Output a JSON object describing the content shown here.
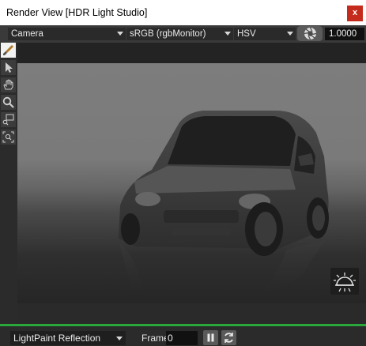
{
  "window": {
    "title": "Render View [HDR Light Studio]",
    "close_label": "x"
  },
  "toolbar": {
    "view_mode": "Camera",
    "color_space": "sRGB (rgbMonitor)",
    "color_model": "HSV",
    "exposure_value": "1.0000"
  },
  "tools": [
    {
      "icon": "paint-brush-icon",
      "active": true
    },
    {
      "icon": "select-arrow-icon",
      "active": false
    },
    {
      "icon": "pan-hand-icon",
      "active": false
    },
    {
      "icon": "zoom-magnifier-icon",
      "active": false
    },
    {
      "icon": "zoom-region-icon",
      "active": false
    },
    {
      "icon": "zoom-fit-icon",
      "active": false
    }
  ],
  "status": {
    "mode": "LightPaint Reflection",
    "frame_label": "Frame",
    "frame_value": "0"
  },
  "colors": {
    "accent_green": "#2aa63a",
    "close_red": "#c42b1c",
    "active_tool": "#f2f2f2"
  }
}
